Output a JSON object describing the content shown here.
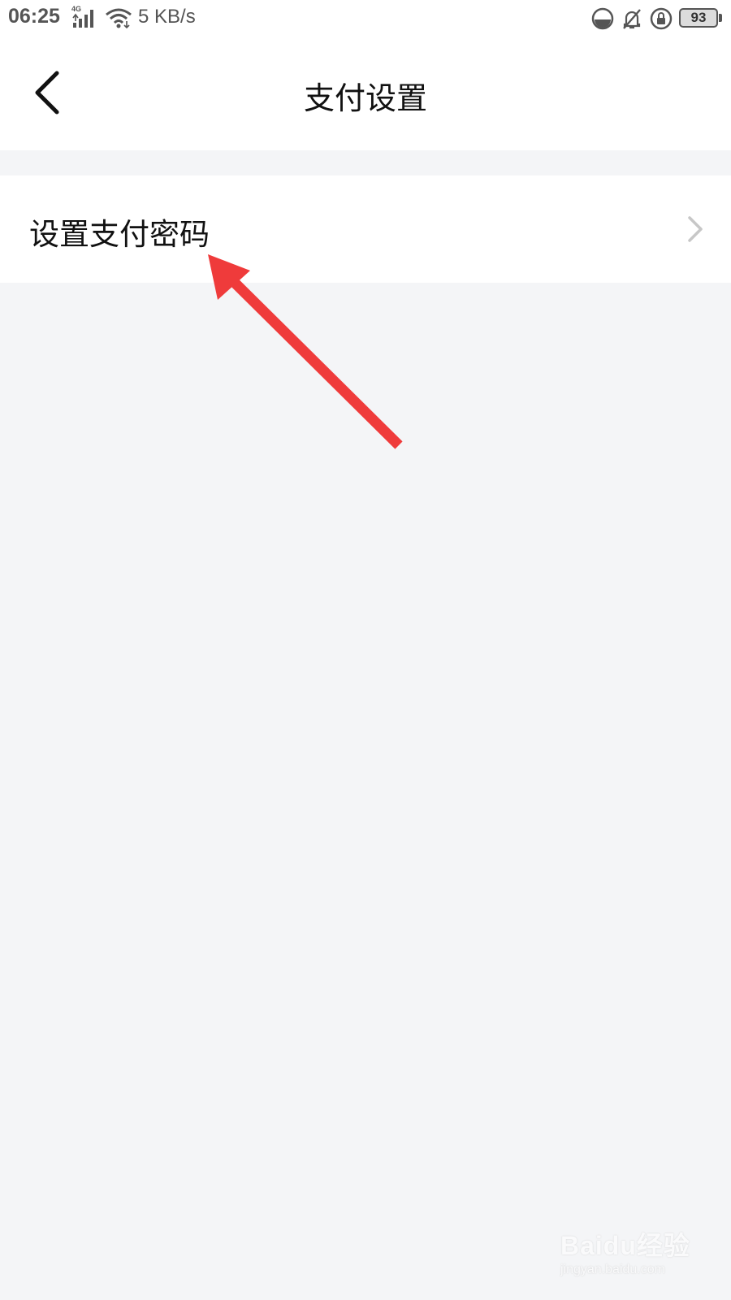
{
  "status_bar": {
    "time": "06:25",
    "network_type": "4G",
    "speed": "5 KB/s",
    "battery_level": "93",
    "icons": [
      "signal-icon",
      "wifi-icon",
      "data-saver-icon",
      "bell-muted-icon",
      "rotation-lock-icon",
      "battery-icon"
    ]
  },
  "header": {
    "title": "支付设置",
    "back_icon": "chevron-left-icon"
  },
  "settings": {
    "items": [
      {
        "label": "设置支付密码",
        "icon": "chevron-right-icon"
      }
    ]
  },
  "annotation": {
    "arrow_color": "#ef3b3b"
  },
  "watermark": {
    "brand": "Baidu经验",
    "url": "jingyan.baidu.com"
  },
  "colors": {
    "page_background": "#f4f5f7",
    "card_background": "#ffffff",
    "text_primary": "#111111",
    "chevron": "#c7c7c7"
  }
}
